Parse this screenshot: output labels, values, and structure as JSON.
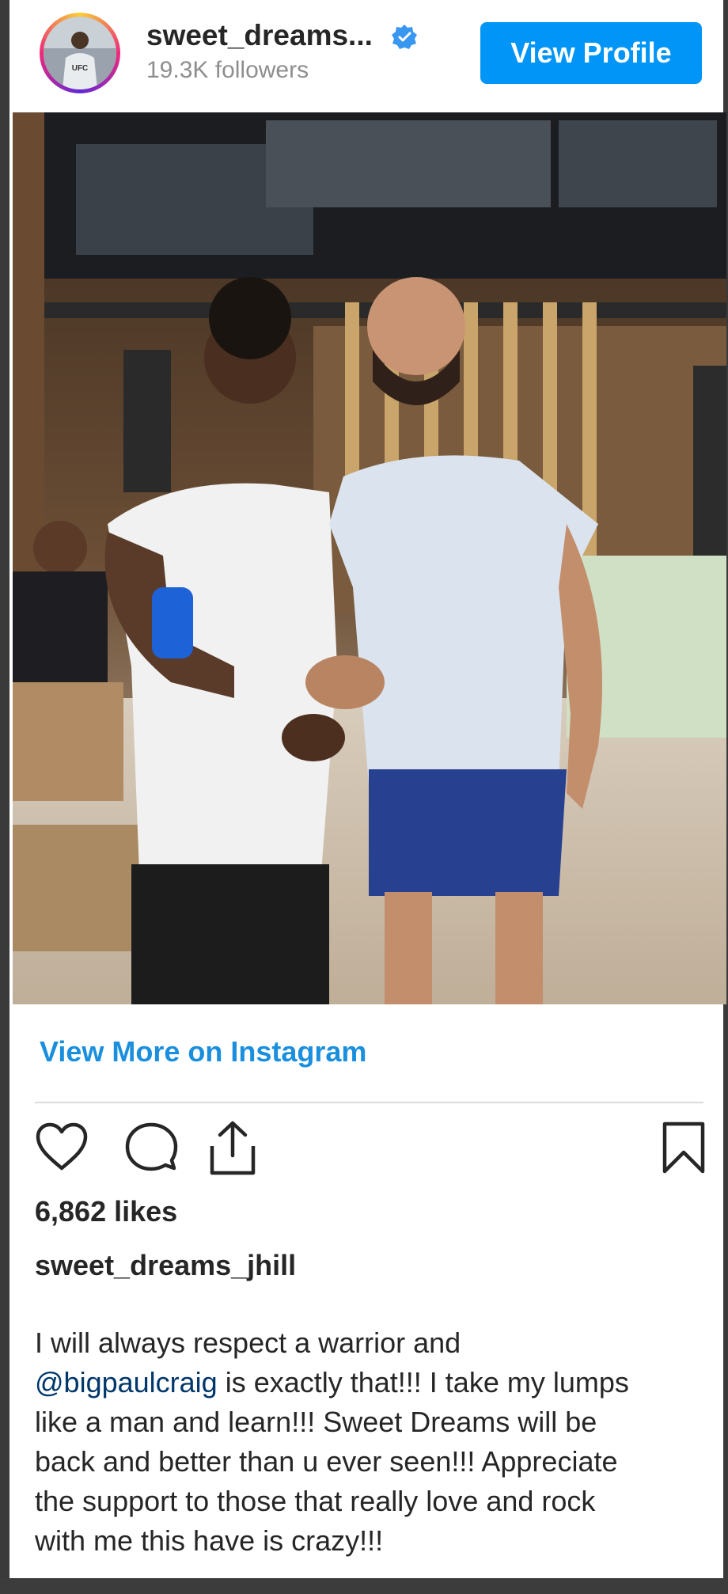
{
  "header": {
    "username": "sweet_dreams...",
    "followers": "19.3K followers",
    "view_profile_label": "View Profile",
    "verified_icon": "verified-badge-icon"
  },
  "photo": {
    "alt": "Two men posing together in a restaurant bar"
  },
  "post": {
    "view_more_label": "View More on Instagram",
    "likes": "6,862 likes",
    "caption_user": "sweet_dreams_jhill",
    "caption_lines": [
      "I will always respect a warrior and",
      "is exactly that!!! I take my lumps",
      "like a man and learn!!! Sweet Dreams will be",
      "back and better than u ever seen!!! Appreciate",
      "the support to those that really love and rock",
      "with me this have is crazy!!!"
    ],
    "mention": "@bigpaulcraig"
  },
  "icons": [
    "heart-icon",
    "comment-icon",
    "share-icon",
    "bookmark-icon"
  ],
  "colors": {
    "accent": "#0095f6",
    "link": "#1a8fdd",
    "mention": "#00376b",
    "text": "#262626",
    "muted": "#8e8e8e"
  }
}
